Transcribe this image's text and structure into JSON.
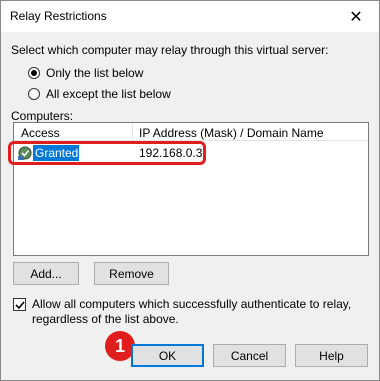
{
  "window": {
    "title": "Relay Restrictions",
    "close_glyph": "✕"
  },
  "instruction": "Select which computer may relay through this virtual server:",
  "radios": [
    {
      "label": "Only the list below",
      "selected": true
    },
    {
      "label": "All except the list below",
      "selected": false
    }
  ],
  "computers": {
    "label": "Computers:",
    "columns": [
      "Access",
      "IP Address (Mask) / Domain Name"
    ],
    "rows": [
      {
        "access": "Granted",
        "address": "192.168.0.3",
        "icon": "computer-granted-icon"
      }
    ]
  },
  "buttons": {
    "add": "Add...",
    "remove": "Remove",
    "ok": "OK",
    "cancel": "Cancel",
    "help": "Help"
  },
  "allow_auth": {
    "label": "Allow all computers which successfully authenticate to relay, regardless of the list above.",
    "checked": true
  },
  "annotation": {
    "number": "1",
    "color": "#e01e1e"
  },
  "colors": {
    "selection": "#0078d7",
    "highlight_outline": "#e01e1e"
  }
}
